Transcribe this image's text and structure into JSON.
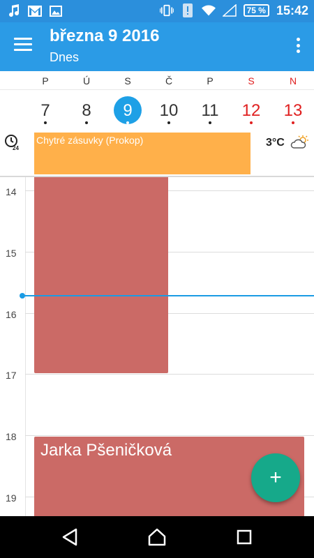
{
  "status_bar": {
    "left_icons": [
      "music-note-icon",
      "gmail-icon",
      "image-icon"
    ],
    "right_icons": [
      "vibrate-icon",
      "alert-icon",
      "wifi-icon",
      "signal-icon"
    ],
    "battery": "75 %",
    "time": "15:42"
  },
  "app_bar": {
    "title": "března 9 2016",
    "subtitle": "Dnes"
  },
  "week": {
    "day_names": [
      "P",
      "Ú",
      "S",
      "Č",
      "P",
      "S",
      "N"
    ],
    "day_numbers": [
      "7",
      "8",
      "9",
      "10",
      "11",
      "12",
      "13"
    ],
    "today_index": 2,
    "weekend_color": "#e02020"
  },
  "all_day": {
    "event_title": "Chytré zásuvky (Prokop)",
    "event_color": "#ffb04a",
    "temperature": "3°C",
    "weather_icon": "partly-cloudy-icon"
  },
  "hours": [
    "14",
    "15",
    "16",
    "17",
    "18",
    "19"
  ],
  "events": [
    {
      "title": "",
      "color": "#cb6a66",
      "start": "13:50",
      "end": "17:00"
    },
    {
      "title": "Jarka Pšeničková",
      "color": "#cb6a66",
      "start": "18:00",
      "end": "19:30"
    }
  ],
  "current_time_line": "15:42",
  "fab_label": "+",
  "nav": [
    "back-icon",
    "home-icon",
    "recents-icon"
  ]
}
